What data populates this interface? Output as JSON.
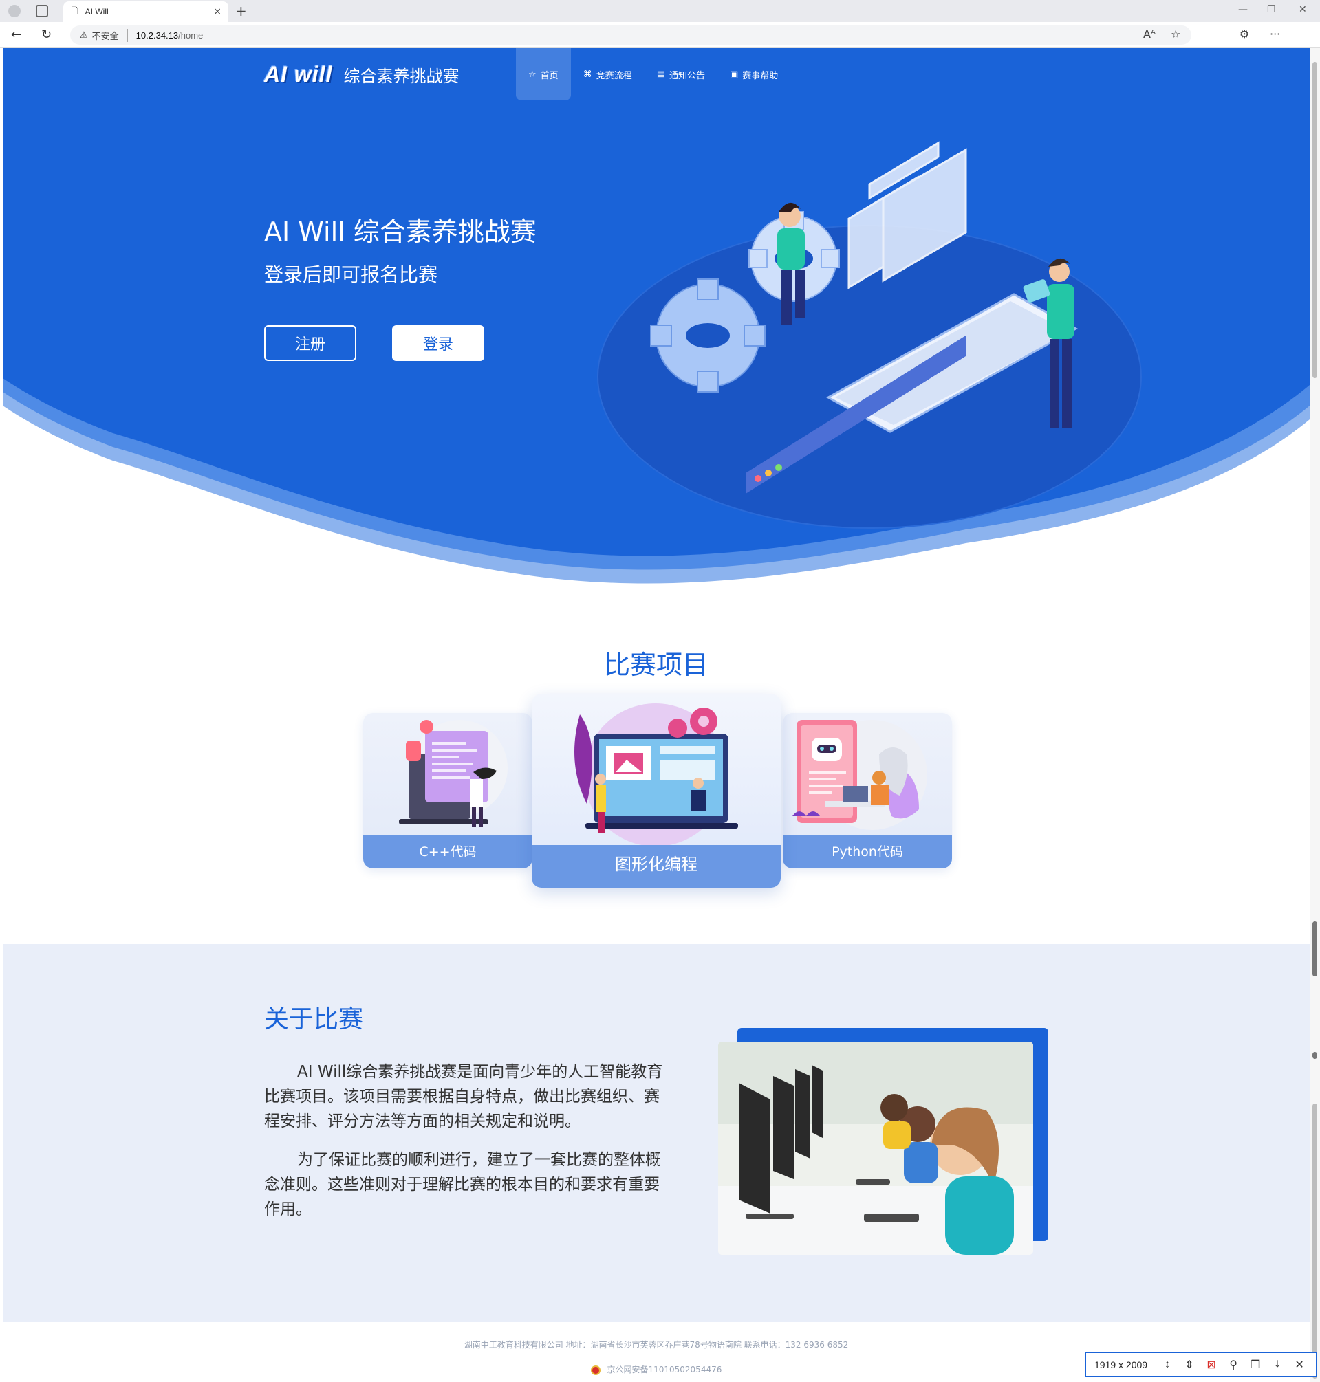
{
  "browser": {
    "tab_title": "AI Will",
    "tab_close": "×",
    "new_tab": "+",
    "address_insecure": "不安全",
    "address_host": "10.2.34.13",
    "address_path": "/home",
    "win_min": "—",
    "win_restore": "❐",
    "win_close": "✕",
    "back": "←",
    "reload": "↻",
    "read_aloud": "Aᴬ",
    "favorite": "☆",
    "extensions": "⚙",
    "more": "···"
  },
  "nav": {
    "logo_mark": "AI will",
    "logo_text": "综合素养挑战赛",
    "items": [
      {
        "label": "首页",
        "icon": "☆",
        "active": true
      },
      {
        "label": "竞赛流程",
        "icon": "⌘"
      },
      {
        "label": "通知公告",
        "icon": "▤"
      },
      {
        "label": "赛事帮助",
        "icon": "▣"
      }
    ]
  },
  "hero": {
    "title": "AI Will 综合素养挑战赛",
    "subtitle": "登录后即可报名比赛",
    "register": "注册",
    "login": "登录"
  },
  "projects": {
    "title": "比赛项目",
    "cards": [
      {
        "label": "C++代码"
      },
      {
        "label": "图形化编程"
      },
      {
        "label": "Python代码"
      }
    ]
  },
  "about": {
    "title": "关于比赛",
    "p1": "AI Will综合素养挑战赛是面向青少年的人工智能教育比赛项目。该项目需要根据自身特点，做出比赛组织、赛程安排、评分方法等方面的相关规定和说明。",
    "p2": "为了保证比赛的顺利进行，建立了一套比赛的整体概念准则。这些准则对于理解比赛的根本目的和要求有重要作用。"
  },
  "footer": {
    "line1": "湖南中工教育科技有限公司 地址：湖南省长沙市芙蓉区乔庄巷78号物语南院 联系电话：132 6936 6852",
    "line2": "京公网安备11010502054476"
  },
  "screenshot_tool": {
    "dimensions": "1919 x 2009"
  },
  "colors": {
    "brand_blue": "#1a63d8",
    "about_bg": "#e9eef9",
    "caption_blue": "#6a98e4"
  }
}
